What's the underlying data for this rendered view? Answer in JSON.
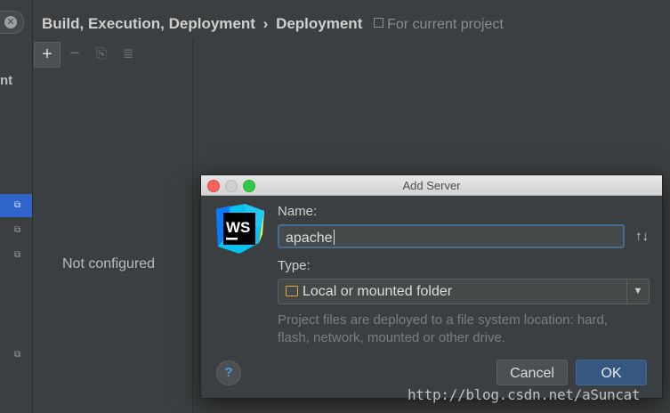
{
  "header": {
    "breadcrumb_parent": "Build, Execution, Deployment",
    "separator": "›",
    "breadcrumb_current": "Deployment",
    "scope_label": "For current project"
  },
  "sidebar": {
    "truncated_label": "nt",
    "search_clear_icon": "✕"
  },
  "toolbar": {
    "add_icon": "+",
    "remove_icon": "−",
    "copy_icon": "⎘",
    "list_icon": "≣"
  },
  "server_list": {
    "empty_text": "Not configured"
  },
  "dialog": {
    "title": "Add Server",
    "name_label": "Name:",
    "name_value": "apache",
    "sort_icon": "↑↓",
    "type_label": "Type:",
    "type_value": "Local or mounted folder",
    "description": "Project files are deployed to a file system location: hard, flash, network, mounted or other drive.",
    "help_label": "?",
    "cancel_label": "Cancel",
    "ok_label": "OK",
    "logo_text": "WS",
    "colors": {
      "ok_button": "#365880",
      "focus_border": "#466d94",
      "selection": "#2f65ca"
    }
  },
  "watermark": "http://blog.csdn.net/aSuncat"
}
